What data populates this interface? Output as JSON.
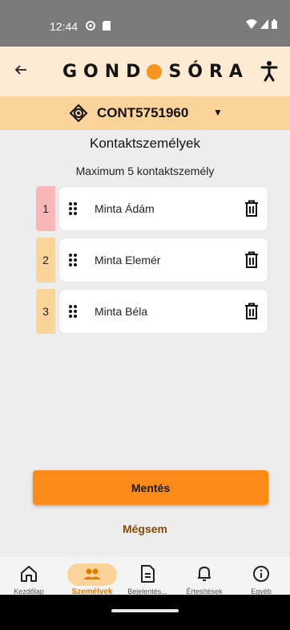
{
  "status_bar": {
    "time": "12:44"
  },
  "header": {
    "logo_left": "GOND",
    "logo_right": "SÓRA",
    "brand_color": "#f7941d"
  },
  "contract": {
    "label": "CONT5751960"
  },
  "page": {
    "title": "Kontaktszemélyek",
    "subtitle": "Maximum 5 kontaktszemély"
  },
  "contacts": [
    {
      "number": "1",
      "name": "Minta Ádám",
      "badge_color": "#f8b7b7"
    },
    {
      "number": "2",
      "name": "Minta Elemér",
      "badge_color": "#fcd39a"
    },
    {
      "number": "3",
      "name": "Minta Béla",
      "badge_color": "#fcd39a"
    }
  ],
  "actions": {
    "save_label": "Mentés",
    "cancel_label": "Mégsem"
  },
  "bottom_nav": [
    {
      "label": "Kezdőlap",
      "icon": "home-icon"
    },
    {
      "label": "Személyek",
      "icon": "people-icon",
      "active": true
    },
    {
      "label": "Bejelentés...",
      "icon": "document-icon"
    },
    {
      "label": "Értesítések",
      "icon": "bell-icon"
    },
    {
      "label": "Egyéb",
      "icon": "info-icon"
    }
  ],
  "accent_color": "#fb8a18"
}
